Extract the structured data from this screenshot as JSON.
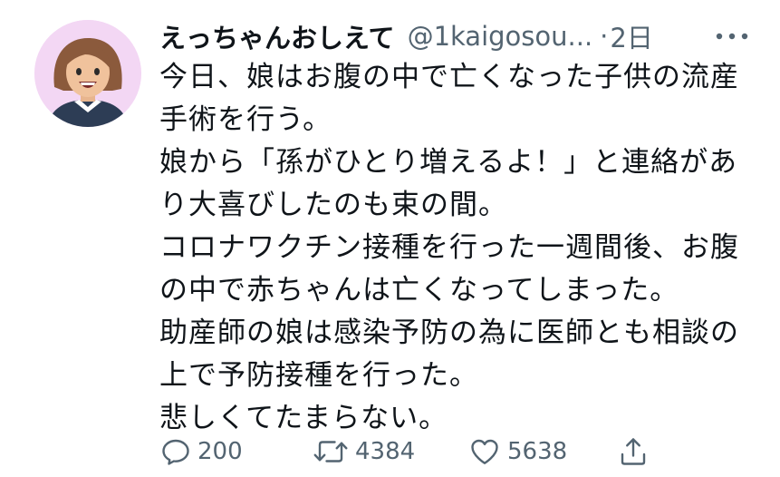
{
  "tweet": {
    "author": {
      "display_name": "えっちゃんおしえて",
      "handle": "@1kaigosou...",
      "separator": "·",
      "time": "2日"
    },
    "more_icon": "more-horizontal-icon",
    "body_lines": [
      "今日、娘はお腹の中で亡くなった子供の流産",
      "手術を行う。",
      "娘から「孫がひとり増えるよ！」と連絡があ",
      "り大喜びしたのも束の間。",
      "コロナワクチン接種を行った一週間後、お腹",
      "の中で赤ちゃんは亡くなってしまった。",
      "助産師の娘は感染予防の為に医師とも相談の",
      "上で予防接種を行った。",
      "悲しくてたまらない。"
    ],
    "actions": {
      "reply": {
        "icon": "reply-icon",
        "count": "200"
      },
      "retweet": {
        "icon": "retweet-icon",
        "count": "4384"
      },
      "like": {
        "icon": "heart-icon",
        "count": "5638"
      },
      "share": {
        "icon": "share-icon"
      }
    }
  },
  "colors": {
    "text": "#0f1419",
    "secondary": "#536471",
    "avatar_bg": "#f3d7f4"
  }
}
